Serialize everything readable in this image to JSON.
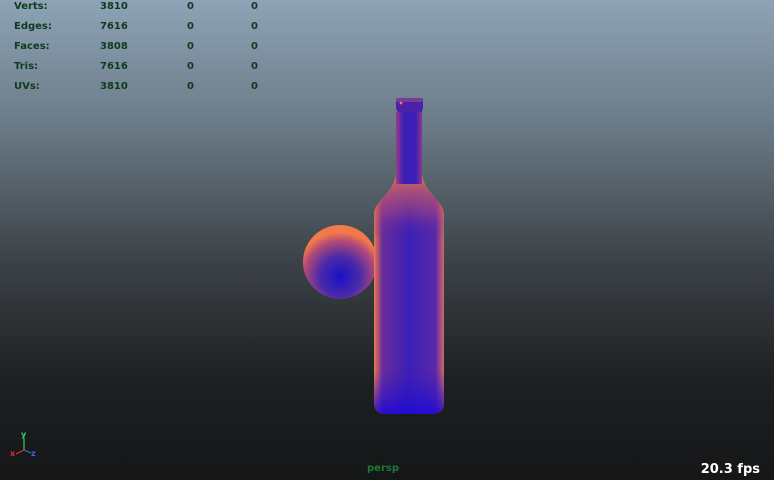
{
  "hud": {
    "rows": [
      {
        "label": "Verts:",
        "total": "3810",
        "selected": "0",
        "component": "0"
      },
      {
        "label": "Edges:",
        "total": "7616",
        "selected": "0",
        "component": "0"
      },
      {
        "label": "Faces:",
        "total": "3808",
        "selected": "0",
        "component": "0"
      },
      {
        "label": "Tris:",
        "total": "7616",
        "selected": "0",
        "component": "0"
      },
      {
        "label": "UVs:",
        "total": "3810",
        "selected": "0",
        "component": "0"
      }
    ]
  },
  "camera": {
    "name": "persp"
  },
  "frame_rate": {
    "text": "20.3 fps"
  },
  "axis_gizmo": {
    "x": "x",
    "y": "y",
    "z": "z"
  },
  "colors": {
    "hud_text": "#0e3a1e",
    "camera_label": "#1f7a35",
    "shading_core": "#3a1fb5",
    "shading_rim": "#f07a4a"
  }
}
